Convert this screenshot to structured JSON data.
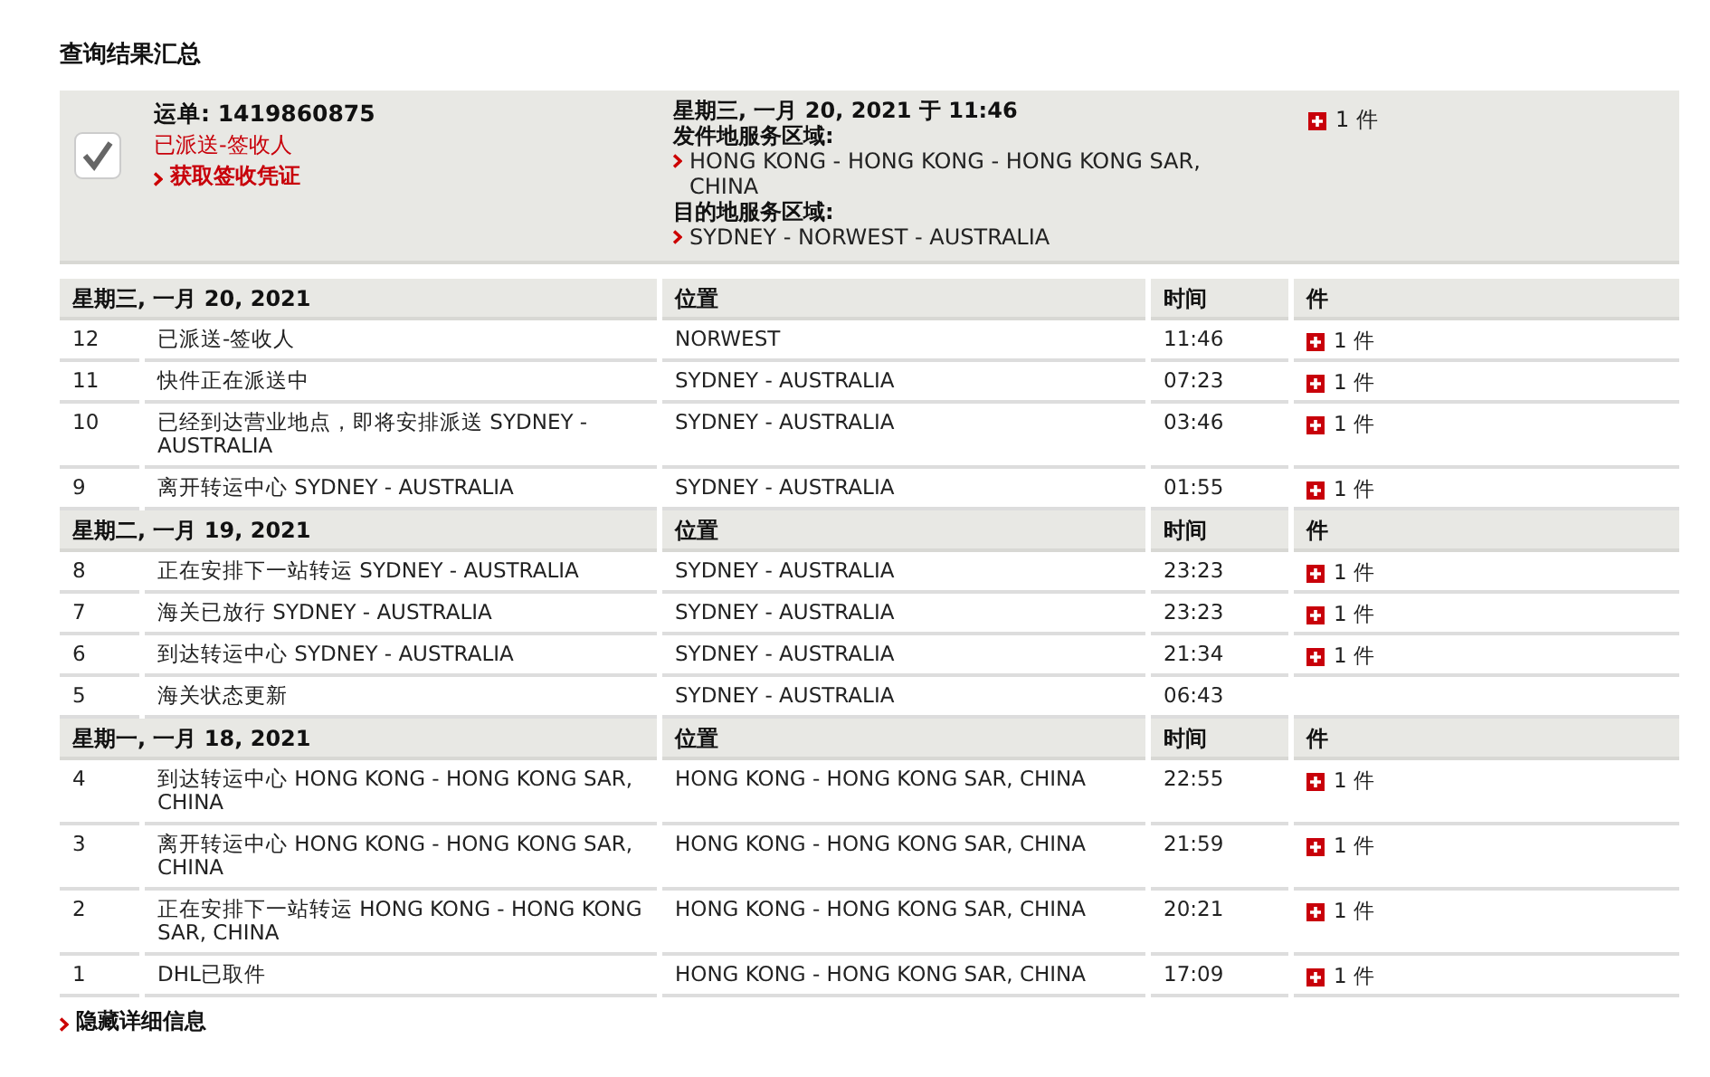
{
  "title": "查询结果汇总",
  "summary": {
    "waybill": "运单: 1419860875",
    "status": "已派送-签收人",
    "proof_link": "获取签收凭证",
    "date": "星期三, 一月 20, 2021 于 11:46",
    "origin_label": "发件地服务区域:",
    "origin": "HONG KONG - HONG KONG - HONG KONG SAR, CHINA",
    "destination_label": "目的地服务区域:",
    "destination": "SYDNEY - NORWEST - AUSTRALIA",
    "pieces": "1 件"
  },
  "groups": [
    {
      "date": "星期三, 一月 20, 2021",
      "location_header": "位置",
      "time_header": "时间",
      "pieces_header": "件",
      "events": [
        {
          "number": "12",
          "description": "已派送-签收人",
          "location": "NORWEST",
          "time": "11:46",
          "pieces": "1 件"
        },
        {
          "number": "11",
          "description": "快件正在派送中",
          "location": "SYDNEY - AUSTRALIA",
          "time": "07:23",
          "pieces": "1 件"
        },
        {
          "number": "10",
          "description": "已经到达营业地点，即将安排派送 SYDNEY - AUSTRALIA",
          "location": "SYDNEY - AUSTRALIA",
          "time": "03:46",
          "pieces": "1 件"
        },
        {
          "number": "9",
          "description": "离开转运中心 SYDNEY - AUSTRALIA",
          "location": "SYDNEY - AUSTRALIA",
          "time": "01:55",
          "pieces": "1 件"
        }
      ]
    },
    {
      "date": "星期二, 一月 19, 2021",
      "location_header": "位置",
      "time_header": "时间",
      "pieces_header": "件",
      "events": [
        {
          "number": "8",
          "description": "正在安排下一站转运 SYDNEY - AUSTRALIA",
          "location": "SYDNEY - AUSTRALIA",
          "time": "23:23",
          "pieces": "1 件"
        },
        {
          "number": "7",
          "description": "海关已放行 SYDNEY - AUSTRALIA",
          "location": "SYDNEY - AUSTRALIA",
          "time": "23:23",
          "pieces": "1 件"
        },
        {
          "number": "6",
          "description": "到达转运中心 SYDNEY - AUSTRALIA",
          "location": "SYDNEY - AUSTRALIA",
          "time": "21:34",
          "pieces": "1 件"
        },
        {
          "number": "5",
          "description": "海关状态更新",
          "location": "SYDNEY - AUSTRALIA",
          "time": "06:43"
        }
      ]
    },
    {
      "date": "星期一, 一月 18, 2021",
      "location_header": "位置",
      "time_header": "时间",
      "pieces_header": "件",
      "events": [
        {
          "number": "4",
          "description": "到达转运中心 HONG KONG - HONG KONG SAR, CHINA",
          "location": "HONG KONG - HONG KONG SAR, CHINA",
          "time": "22:55",
          "pieces": "1 件"
        },
        {
          "number": "3",
          "description": "离开转运中心 HONG KONG - HONG KONG SAR, CHINA",
          "location": "HONG KONG - HONG KONG SAR, CHINA",
          "time": "21:59",
          "pieces": "1 件"
        },
        {
          "number": "2",
          "description": "正在安排下一站转运 HONG KONG - HONG KONG SAR, CHINA",
          "location": "HONG KONG - HONG KONG SAR, CHINA",
          "time": "20:21",
          "pieces": "1 件"
        },
        {
          "number": "1",
          "description": "DHL已取件",
          "location": "HONG KONG - HONG KONG SAR, CHINA",
          "time": "17:09",
          "pieces": "1 件"
        }
      ]
    }
  ],
  "toggle": "隐藏详细信息"
}
